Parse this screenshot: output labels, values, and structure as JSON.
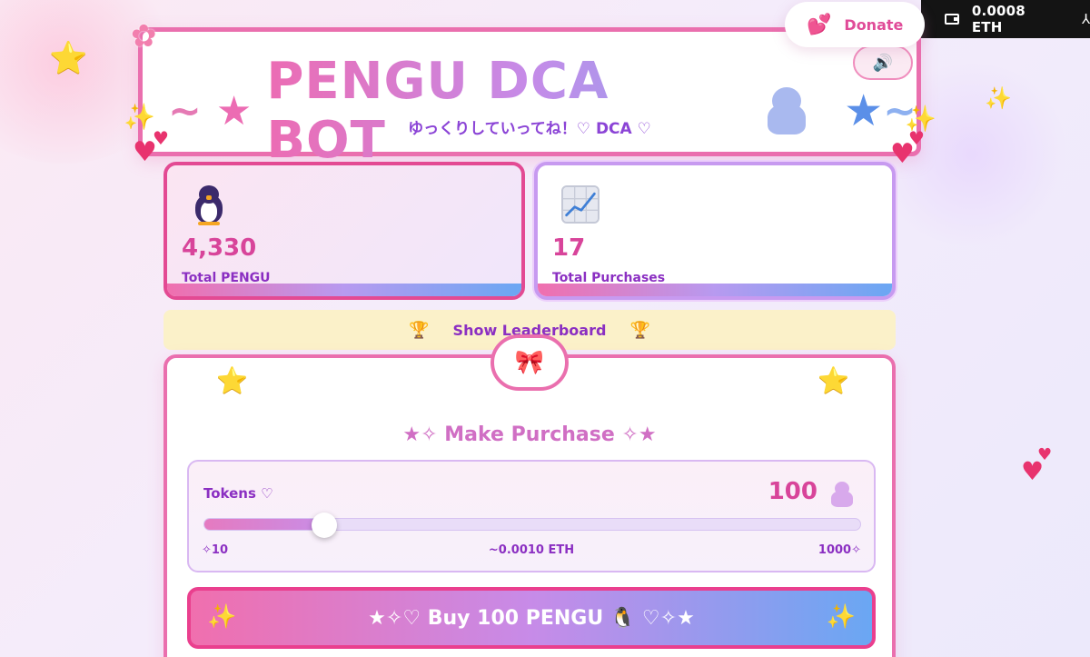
{
  "wallet": {
    "balance": "0.0008 ETH",
    "menu_glyph": "⅄"
  },
  "donate": {
    "label": "Donate",
    "icon": "heart-icon"
  },
  "header": {
    "tilde_left": "~",
    "star_left": "★",
    "title": "PENGU DCA BOT",
    "star_right": "★",
    "tilde_right": "~",
    "subtitle": "ゆっくりしていってね！♡ DCA ♡",
    "sound_glyph": "🔊"
  },
  "stats": {
    "pengu": {
      "value": "4,330",
      "label": "Total PENGU",
      "icon": "penguin-icon"
    },
    "purchases": {
      "value": "17",
      "label": "Total Purchases",
      "icon": "chart-icon"
    }
  },
  "leaderboard": {
    "label": "Show Leaderboard",
    "trophy": "🏆"
  },
  "purchase": {
    "bow": "🎀",
    "title": "★✧ Make Purchase ✧★",
    "tokens_label": "Tokens ♡",
    "amount": "100",
    "slider": {
      "min": 10,
      "max": 1000,
      "value": 100
    },
    "min_label": "✧10",
    "estimate": "~0.0010 ETH",
    "max_label": "1000✧",
    "buy_label": "★✧♡ Buy 100 PENGU 🐧 ♡✧★"
  },
  "decor": {
    "star": "⭐",
    "sparkle": "✨",
    "heart": "♥",
    "sakura": "✿"
  },
  "colors": {
    "primary_pink": "#ea6fae",
    "accent_purple": "#8b2fc2",
    "accent_blue": "#6aa7f3"
  }
}
